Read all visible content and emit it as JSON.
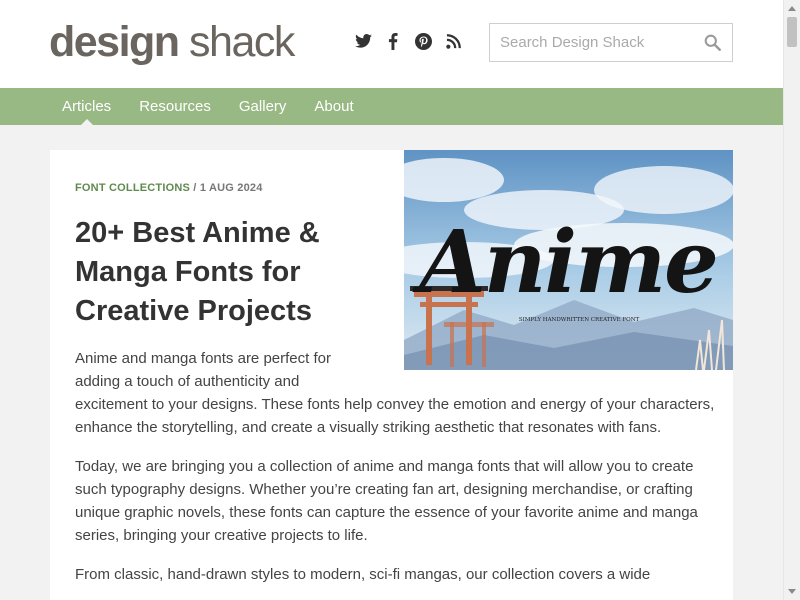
{
  "header": {
    "logo_bold": "design",
    "logo_light": "shack",
    "social": [
      "twitter-icon",
      "facebook-icon",
      "pinterest-icon",
      "rss-icon"
    ],
    "search": {
      "placeholder": "Search Design Shack"
    }
  },
  "nav": {
    "items": [
      {
        "label": "Articles",
        "active": true
      },
      {
        "label": "Resources"
      },
      {
        "label": "Gallery"
      },
      {
        "label": "About"
      }
    ]
  },
  "article": {
    "category": "FONT COLLECTIONS",
    "date": "1 AUG 2024",
    "title": "20+ Best Anime & Manga Fonts for Creative Projects",
    "hero": {
      "word": "Anime",
      "caption": "SIMPLY HANDWRITTEN CREATIVE FONT"
    },
    "paragraphs": [
      "Anime and manga fonts are perfect for adding a touch of authenticity and excitement to your designs. These fonts help convey the emotion and energy of your characters, enhance the storytelling, and create a visually striking aesthetic that resonates with fans.",
      "Today, we are bringing you a collection of anime and manga fonts that will allow you to create such typography designs. Whether you’re creating fan art, designing merchandise, or crafting unique graphic novels, these fonts can capture the essence of your favorite anime and manga series, bringing your creative projects to life.",
      "From classic, hand-drawn styles to modern, sci-fi mangas, our collection covers a wide"
    ]
  },
  "colors": {
    "nav_bg": "#98b884",
    "category": "#5f8a4e",
    "logo": "#6b6560"
  }
}
